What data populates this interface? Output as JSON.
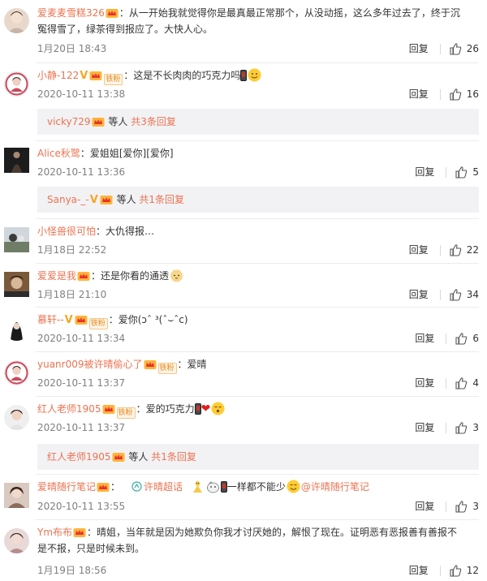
{
  "comments": [
    {
      "name": "爱麦麦雪糕326",
      "text_lines": [
        "：从一开始我就觉得你是最真最正常那个，从没动摇，这么多年过去了，终于沉",
        "冤得雪了，绿茶得到报应了。大快人心。"
      ],
      "time": "1月20日 18:43",
      "reply": "回复",
      "likes": "26"
    },
    {
      "name": "小静-122",
      "fan_badge": "铁粉",
      "text": "：这是不长肉肉的巧克力吗",
      "time": "2020-10-11 13:38",
      "reply": "回复",
      "likes": "16",
      "sub": {
        "name": "vicky729",
        "suffix": " 等人 ",
        "count": "共3条回复"
      }
    },
    {
      "name": "Alice秋鹭",
      "text": "：爱姐姐[爱你][爱你]",
      "time": "2020-10-11 13:36",
      "reply": "回复",
      "likes": "5",
      "sub": {
        "name": "Sanya-_-",
        "suffix": " 等人 ",
        "count": "共1条回复"
      }
    },
    {
      "name": "小怪兽很可怕",
      "text": "：大仇得报…",
      "time": "1月18日 22:52",
      "reply": "回复",
      "likes": "22"
    },
    {
      "name": "爱爱是我",
      "text": "：还是你看的通透",
      "time": "1月18日 21:10",
      "reply": "回复",
      "likes": "34"
    },
    {
      "name": "慕轩--",
      "fan_badge": "铁粉",
      "text": "：爱你(ɔˆ ³(ˆ⌣ˆc)",
      "time": "2020-10-11 13:34",
      "reply": "回复",
      "likes": "6"
    },
    {
      "name": "yuanr009被许晴偷心了",
      "fan_badge": "铁粉",
      "text": "：爱晴",
      "time": "2020-10-11 13:37",
      "reply": "回复",
      "likes": "4"
    },
    {
      "name": "红人老师1905",
      "fan_badge": "铁粉",
      "text": "：爱的巧克力",
      "time": "2020-10-11 13:37",
      "reply": "回复",
      "likes": "3",
      "sub": {
        "name": "红人老师1905",
        "suffix": " 等人 ",
        "count": "共1条回复"
      }
    },
    {
      "name": "爱晴随行笔记",
      "colon": "：",
      "topic": "许晴超话",
      "text": "一样都不能少",
      "mention": "@许晴随行笔记",
      "time": "2020-10-11 13:55",
      "reply": "回复",
      "likes": "3"
    },
    {
      "name": "Ym布布",
      "text_lines": [
        "：晴姐，当年就是因为她欺负你我才讨厌她的，解恨了现在。证明恶有恶报善有善报不",
        "是不报，只是时候未到。"
      ],
      "time": "1月19日 18:56",
      "reply": "回复",
      "likes": "12"
    }
  ],
  "colors": {
    "username": "#eb7350",
    "time": "#808080",
    "sub_bg": "#f2f2f5",
    "text": "#333333"
  },
  "icons": [
    "avatar",
    "vip-crown-icon",
    "verified-v-icon",
    "fan-badge",
    "thumbs-up-icon",
    "topic-icon",
    "emoji-icon",
    "heart-icon"
  ]
}
